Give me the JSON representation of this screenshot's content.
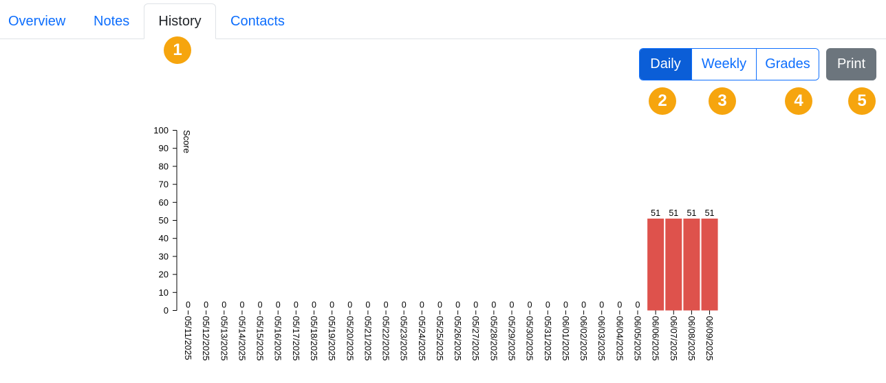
{
  "tabs": [
    {
      "label": "Overview",
      "active": false
    },
    {
      "label": "Notes",
      "active": false
    },
    {
      "label": "History",
      "active": true
    },
    {
      "label": "Contacts",
      "active": false
    }
  ],
  "view_toggle": [
    {
      "label": "Daily",
      "active": true
    },
    {
      "label": "Weekly",
      "active": false
    },
    {
      "label": "Grades",
      "active": false
    }
  ],
  "print_label": "Print",
  "callouts": [
    "1",
    "2",
    "3",
    "4",
    "5"
  ],
  "colors": {
    "link": "#0d6efd",
    "active_toggle": "#0b5ed7",
    "print_button": "#6c757d",
    "callout": "#f6a50e",
    "bar": "#de524c"
  },
  "chart_data": {
    "type": "bar",
    "ylabel": "Score",
    "ylim": [
      0,
      100
    ],
    "yticks": [
      0,
      10,
      20,
      30,
      40,
      50,
      60,
      70,
      80,
      90,
      100
    ],
    "categories": [
      "05/11/2025",
      "05/12/2025",
      "05/13/2025",
      "05/14/2025",
      "05/15/2025",
      "05/16/2025",
      "05/17/2025",
      "05/18/2025",
      "05/19/2025",
      "05/20/2025",
      "05/21/2025",
      "05/22/2025",
      "05/23/2025",
      "05/24/2025",
      "05/25/2025",
      "05/26/2025",
      "05/27/2025",
      "05/28/2025",
      "05/29/2025",
      "05/30/2025",
      "05/31/2025",
      "06/01/2025",
      "06/02/2025",
      "06/03/2025",
      "06/04/2025",
      "06/05/2025",
      "06/06/2025",
      "06/07/2025",
      "06/08/2025",
      "06/09/2025"
    ],
    "values": [
      0,
      0,
      0,
      0,
      0,
      0,
      0,
      0,
      0,
      0,
      0,
      0,
      0,
      0,
      0,
      0,
      0,
      0,
      0,
      0,
      0,
      0,
      0,
      0,
      0,
      0,
      51,
      51,
      51,
      51
    ]
  }
}
